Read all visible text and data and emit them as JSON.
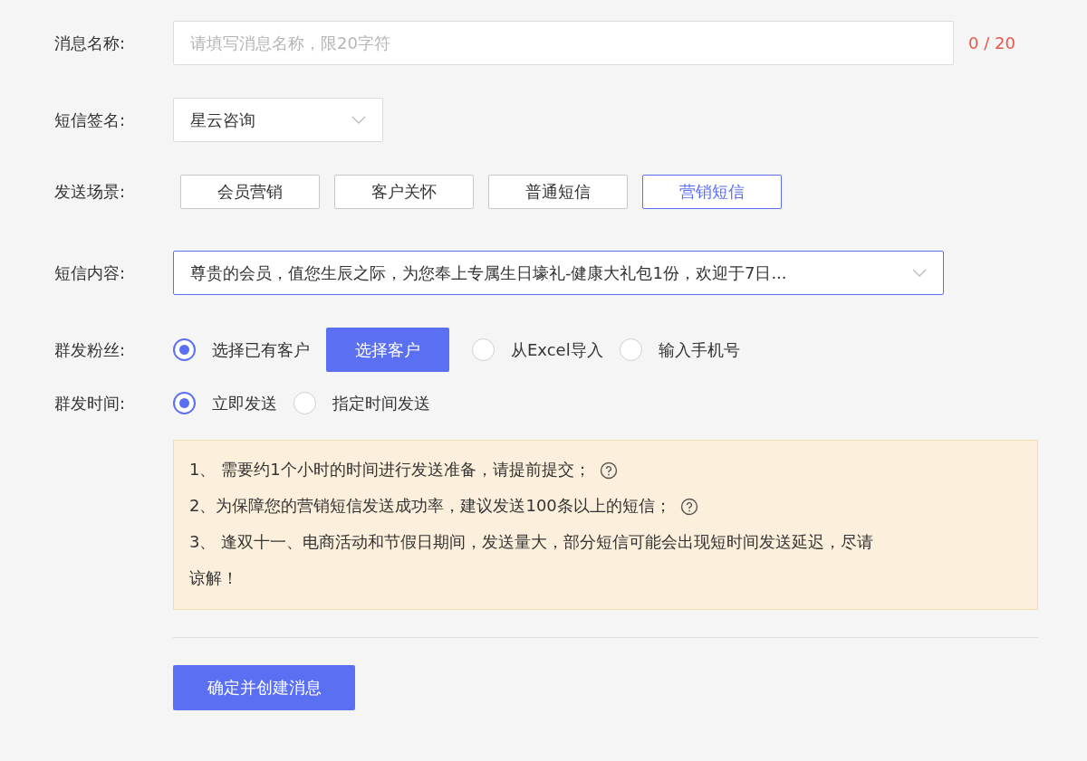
{
  "form": {
    "name": {
      "label": "消息名称:",
      "placeholder": "请填写消息名称，限20字符",
      "counter": "0 / 20"
    },
    "signature": {
      "label": "短信签名:",
      "value": "星云咨询"
    },
    "scene": {
      "label": "发送场景:",
      "options": [
        {
          "label": "会员营销",
          "selected": false
        },
        {
          "label": "客户关怀",
          "selected": false
        },
        {
          "label": "普通短信",
          "selected": false
        },
        {
          "label": "营销短信",
          "selected": true
        }
      ]
    },
    "content": {
      "label": "短信内容:",
      "value": "尊贵的会员，值您生辰之际，为您奉上专属生日壕礼-健康大礼包1份，欢迎于7日...",
      "focused": true
    },
    "recipients": {
      "label": "群发粉丝:",
      "options": [
        {
          "label": "选择已有客户",
          "selected": true,
          "button": "选择客户"
        },
        {
          "label": "从Excel导入",
          "selected": false
        },
        {
          "label": "输入手机号",
          "selected": false
        }
      ]
    },
    "send_time": {
      "label": "群发时间:",
      "options": [
        {
          "label": "立即发送",
          "selected": true
        },
        {
          "label": "指定时间发送",
          "selected": false
        }
      ]
    },
    "notes": [
      {
        "text": "1、 需要约1个小时的时间进行发送准备，请提前提交；",
        "help": true
      },
      {
        "text": "2、为保障您的营销短信发送成功率，建议发送100条以上的短信；",
        "help": true
      },
      {
        "text": "3、 逢双十一、电商活动和节假日期间，发送量大，部分短信可能会出现短时间发送延迟，尽请谅解！",
        "help": false
      }
    ],
    "submit": "确定并创建消息"
  }
}
